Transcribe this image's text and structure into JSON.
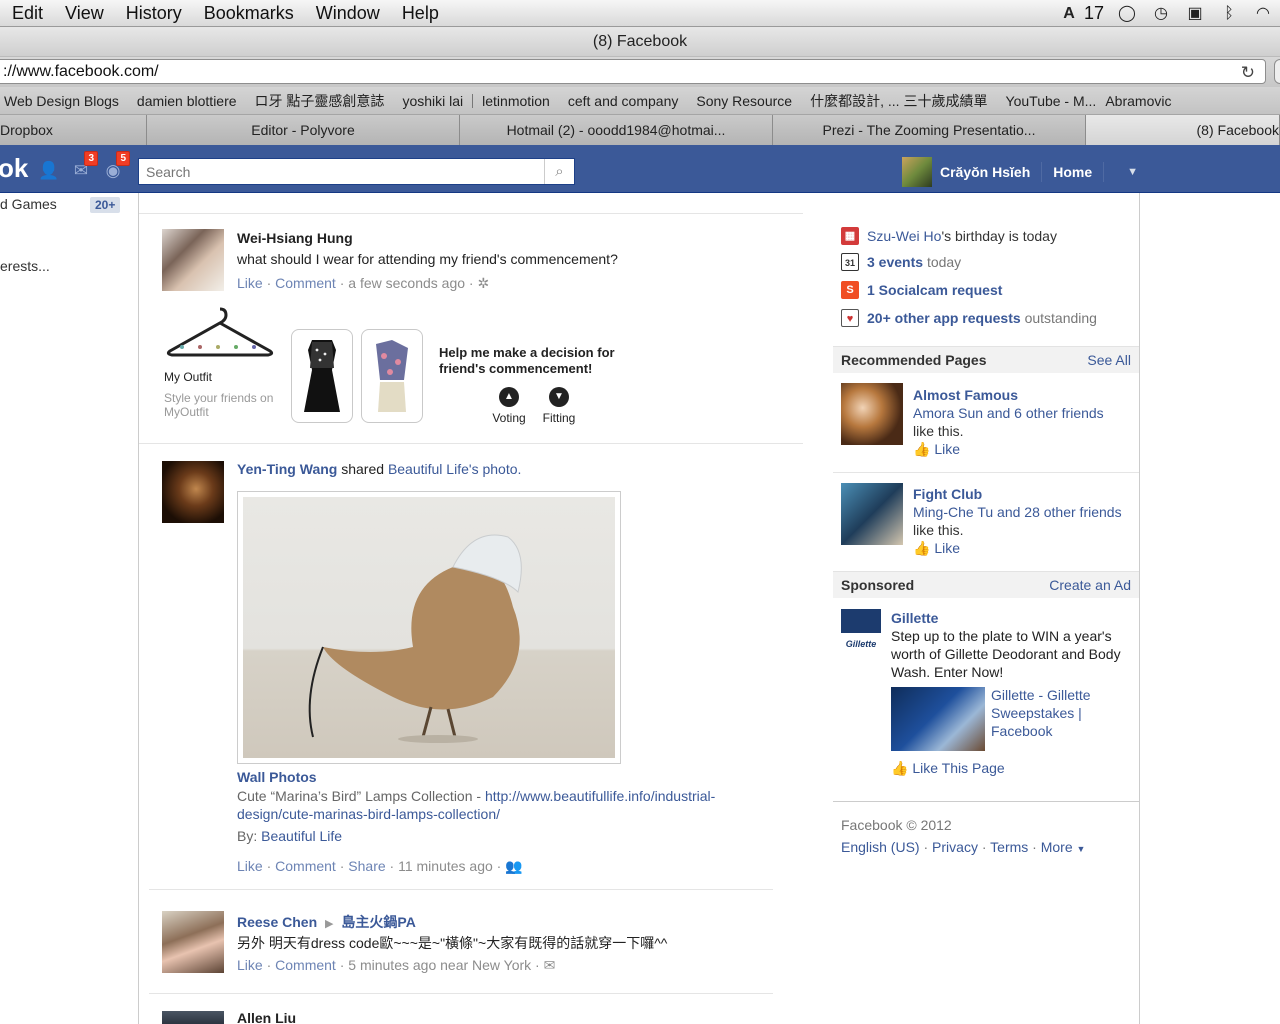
{
  "menubar": {
    "items": [
      "Edit",
      "View",
      "History",
      "Bookmarks",
      "Window",
      "Help"
    ],
    "tray_number": "17"
  },
  "window": {
    "title": "(8) Facebook"
  },
  "address": {
    "url": "://www.facebook.com/"
  },
  "bookmarks": [
    "Web Design Blogs",
    "damien blottiere",
    "ロ牙 點子靈感創意誌",
    "yoshiki lai",
    "letinmotion",
    "ceft and company",
    "Sony Resource",
    "什麼都設計, ...",
    "三十歲成績單",
    "YouTube - M...",
    "Abramovic"
  ],
  "tabs": [
    "Dropbox",
    "Editor - Polyvore",
    "Hotmail (2) - ooodd1984@hotmai...",
    "Prezi - The Zooming Presentatio...",
    "(8) Facebook"
  ],
  "fb": {
    "logo": "ok",
    "friend_count": "",
    "messages_count": "3",
    "notifications_count": "5",
    "search_placeholder": "Search",
    "user_name": "Crăyŏn Hsĭeh",
    "home_label": "Home"
  },
  "leftnav": {
    "games_label": "d Games",
    "games_count": "20+",
    "interests_label": "erests..."
  },
  "stories": [
    {
      "actor": "Wei-Hsiang Hung",
      "text": "what should I wear for attending my friend's commencement?",
      "like": "Like",
      "comment": "Comment",
      "time": "a few seconds ago",
      "outfit": {
        "app_name": "My Outfit",
        "app_sub": "Style your friends on MyOutfit",
        "prompt": "Help me make a decision for friend's commencement!",
        "vote_label": "Voting",
        "fit_label": "Fitting"
      }
    },
    {
      "actor": "Yen-Ting Wang",
      "shared": "shared",
      "owner": "Beautiful Life",
      "owner_suffix": "'s",
      "object": "photo.",
      "album": "Wall Photos",
      "caption_prefix": "Cute “Marina’s Bird” Lamps Collection - ",
      "caption_link": "http://www.beautifullife.info/industrial-design/cute-marinas-bird-lamps-collection/",
      "by_label": "By:",
      "by_link": "Beautiful Life",
      "like": "Like",
      "comment": "Comment",
      "share": "Share",
      "time": "11 minutes ago"
    },
    {
      "actor": "Reese Chen",
      "target": "島主火鍋PA",
      "text": "另外 明天有dress code歐~~~是~\"橫條\"~大家有既得的話就穿一下囉^^",
      "like": "Like",
      "comment": "Comment",
      "time": "5 minutes ago near New York"
    },
    {
      "actor": "Allen Liu"
    }
  ],
  "rail": {
    "birthday_name": "Szu-Wei Ho",
    "birthday_text": "'s birthday is today",
    "events_link": "3 events",
    "events_text": "today",
    "socialcam": "1 Socialcam request",
    "apps_link": "20+ other app requests",
    "apps_text": "outstanding",
    "recommended_title": "Recommended Pages",
    "see_all": "See All",
    "pages": [
      {
        "name": "Almost Famous",
        "friend": "Amora Sun",
        "others": " and 6 other friends",
        "tail": "like this.",
        "like": "Like"
      },
      {
        "name": "Fight Club",
        "friend": "Ming-Che Tu",
        "others": " and 28 other friends",
        "tail": " like this.",
        "like": "Like"
      }
    ],
    "sponsored_title": "Sponsored",
    "create_ad": "Create an Ad",
    "ad": {
      "name": "Gillette",
      "body": "Step up to the plate to WIN a year's worth of Gillette Deodorant and Body Wash. Enter Now!",
      "logo_text": "Gillette",
      "link_title": "Gillette - Gillette Sweepstakes | Facebook",
      "like_page": "Like This Page"
    },
    "footer_copy": "Facebook © 2012",
    "footer_links": [
      "English (US)",
      "Privacy",
      "Terms",
      "More"
    ]
  }
}
